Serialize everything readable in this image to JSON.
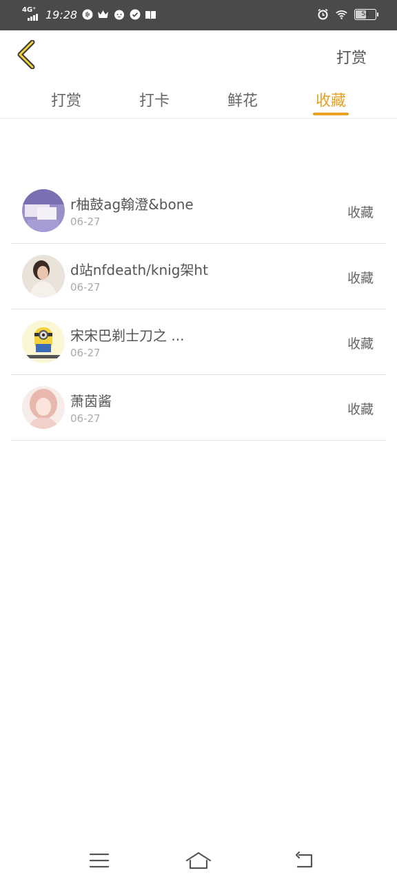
{
  "status_bar": {
    "network": "4G⁺",
    "time": "19:28",
    "battery": "54"
  },
  "header": {
    "back_icon": "chevron-left-icon",
    "action_label": "打赏",
    "accent_color": "#e8a023"
  },
  "tabs": [
    {
      "label": "打赏",
      "active": false
    },
    {
      "label": "打卡",
      "active": false
    },
    {
      "label": "鲜花",
      "active": false
    },
    {
      "label": "收藏",
      "active": true
    }
  ],
  "items": [
    {
      "name": "r柚鼓ag翰澄&bone",
      "date": "06-27",
      "type": "收藏"
    },
    {
      "name": "d站nfdeath/knig架ht",
      "date": "06-27",
      "type": "收藏"
    },
    {
      "name": "宋宋巴剃士刀之 ...",
      "date": "06-27",
      "type": "收藏"
    },
    {
      "name": "萧茵酱",
      "date": "06-27",
      "type": "收藏"
    }
  ],
  "nav": {
    "menu_icon": "menu-icon",
    "home_icon": "home-icon",
    "back_icon": "return-icon"
  }
}
